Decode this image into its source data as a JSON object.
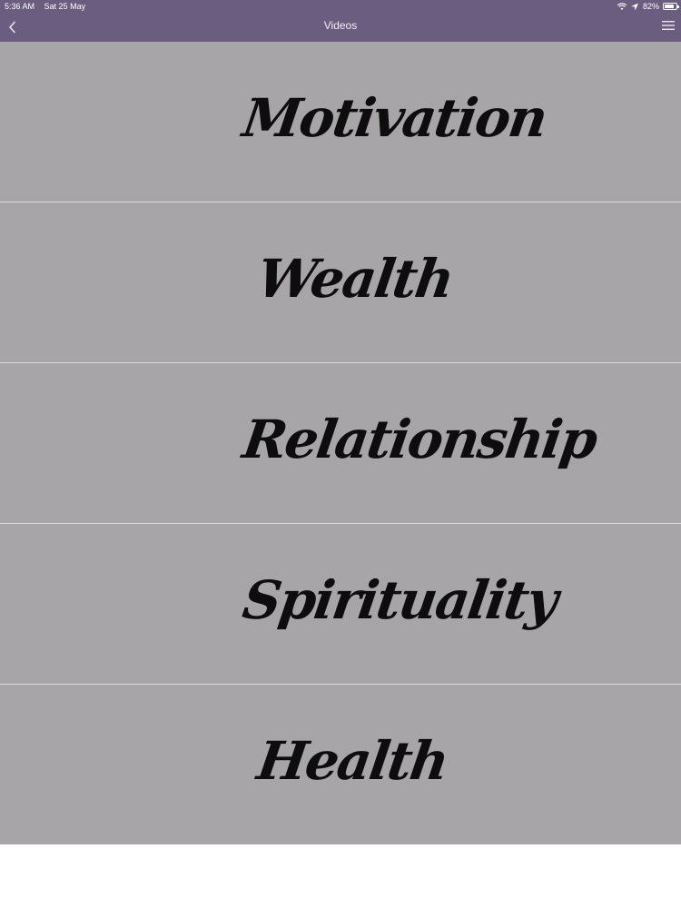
{
  "status_bar": {
    "time": "5:36 AM",
    "date": "Sat 25 May",
    "battery_percent": "82%",
    "battery_level": 0.82,
    "icons": [
      "wifi-icon",
      "location-arrow-icon",
      "battery-icon"
    ]
  },
  "nav": {
    "title": "Videos",
    "back_icon": "chevron-left-icon",
    "menu_icon": "hamburger-menu-icon"
  },
  "categories": [
    {
      "label": "Motivation"
    },
    {
      "label": "Wealth"
    },
    {
      "label": "Relationship"
    },
    {
      "label": "Spirituality"
    },
    {
      "label": "Health"
    }
  ],
  "colors": {
    "header": "#6b5d80",
    "list_background": "#a7a5a8",
    "divider": "#dcdadd",
    "label_text": "#0d0d0d"
  }
}
